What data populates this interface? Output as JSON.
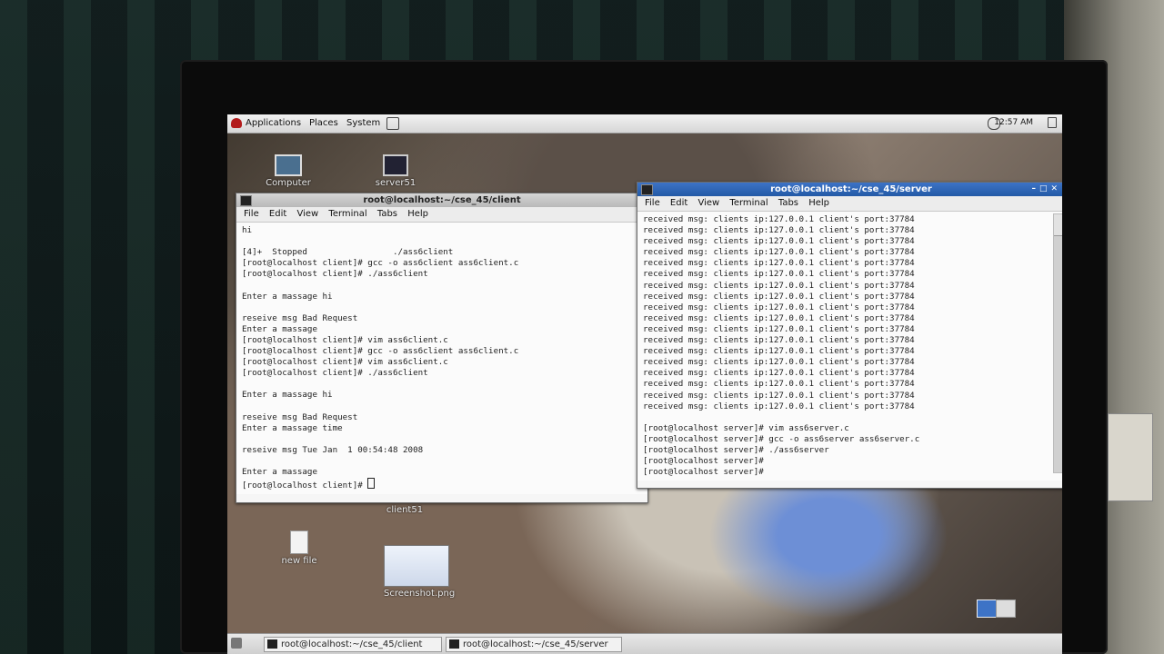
{
  "top_panel": {
    "menus": [
      "Applications",
      "Places",
      "System"
    ],
    "clock": "12:57 AM"
  },
  "desktop_icons": {
    "computer": "Computer",
    "server51": "server51",
    "client51": "client51",
    "new_file": "new file",
    "screenshot": "Screenshot.png"
  },
  "client_window": {
    "title": "root@localhost:~/cse_45/client",
    "menu": [
      "File",
      "Edit",
      "View",
      "Terminal",
      "Tabs",
      "Help"
    ],
    "lines": [
      "hi",
      "",
      "[4]+  Stopped                 ./ass6client",
      "[root@localhost client]# gcc -o ass6client ass6client.c",
      "[root@localhost client]# ./ass6client",
      "",
      "Enter a massage hi",
      "",
      "reseive msg Bad Request",
      "Enter a massage",
      "[root@localhost client]# vim ass6client.c",
      "[root@localhost client]# gcc -o ass6client ass6client.c",
      "[root@localhost client]# vim ass6client.c",
      "[root@localhost client]# ./ass6client",
      "",
      "Enter a massage hi",
      "",
      "reseive msg Bad Request",
      "Enter a massage time",
      "",
      "reseive msg Tue Jan  1 00:54:48 2008",
      "",
      "Enter a massage"
    ],
    "prompt": "[root@localhost client]# "
  },
  "server_window": {
    "title": "root@localhost:~/cse_45/server",
    "menu": [
      "File",
      "Edit",
      "View",
      "Terminal",
      "Tabs",
      "Help"
    ],
    "received_line": "received msg: clients ip:127.0.0.1 client's port:37784",
    "received_count": 18,
    "lines": [
      "",
      "[root@localhost server]# vim ass6server.c",
      "[root@localhost server]# gcc -o ass6server ass6server.c",
      "[root@localhost server]# ./ass6server",
      "[root@localhost server]#",
      "[root@localhost server]#"
    ]
  },
  "taskbar": {
    "tasks": [
      "root@localhost:~/cse_45/client",
      "root@localhost:~/cse_45/server"
    ]
  }
}
